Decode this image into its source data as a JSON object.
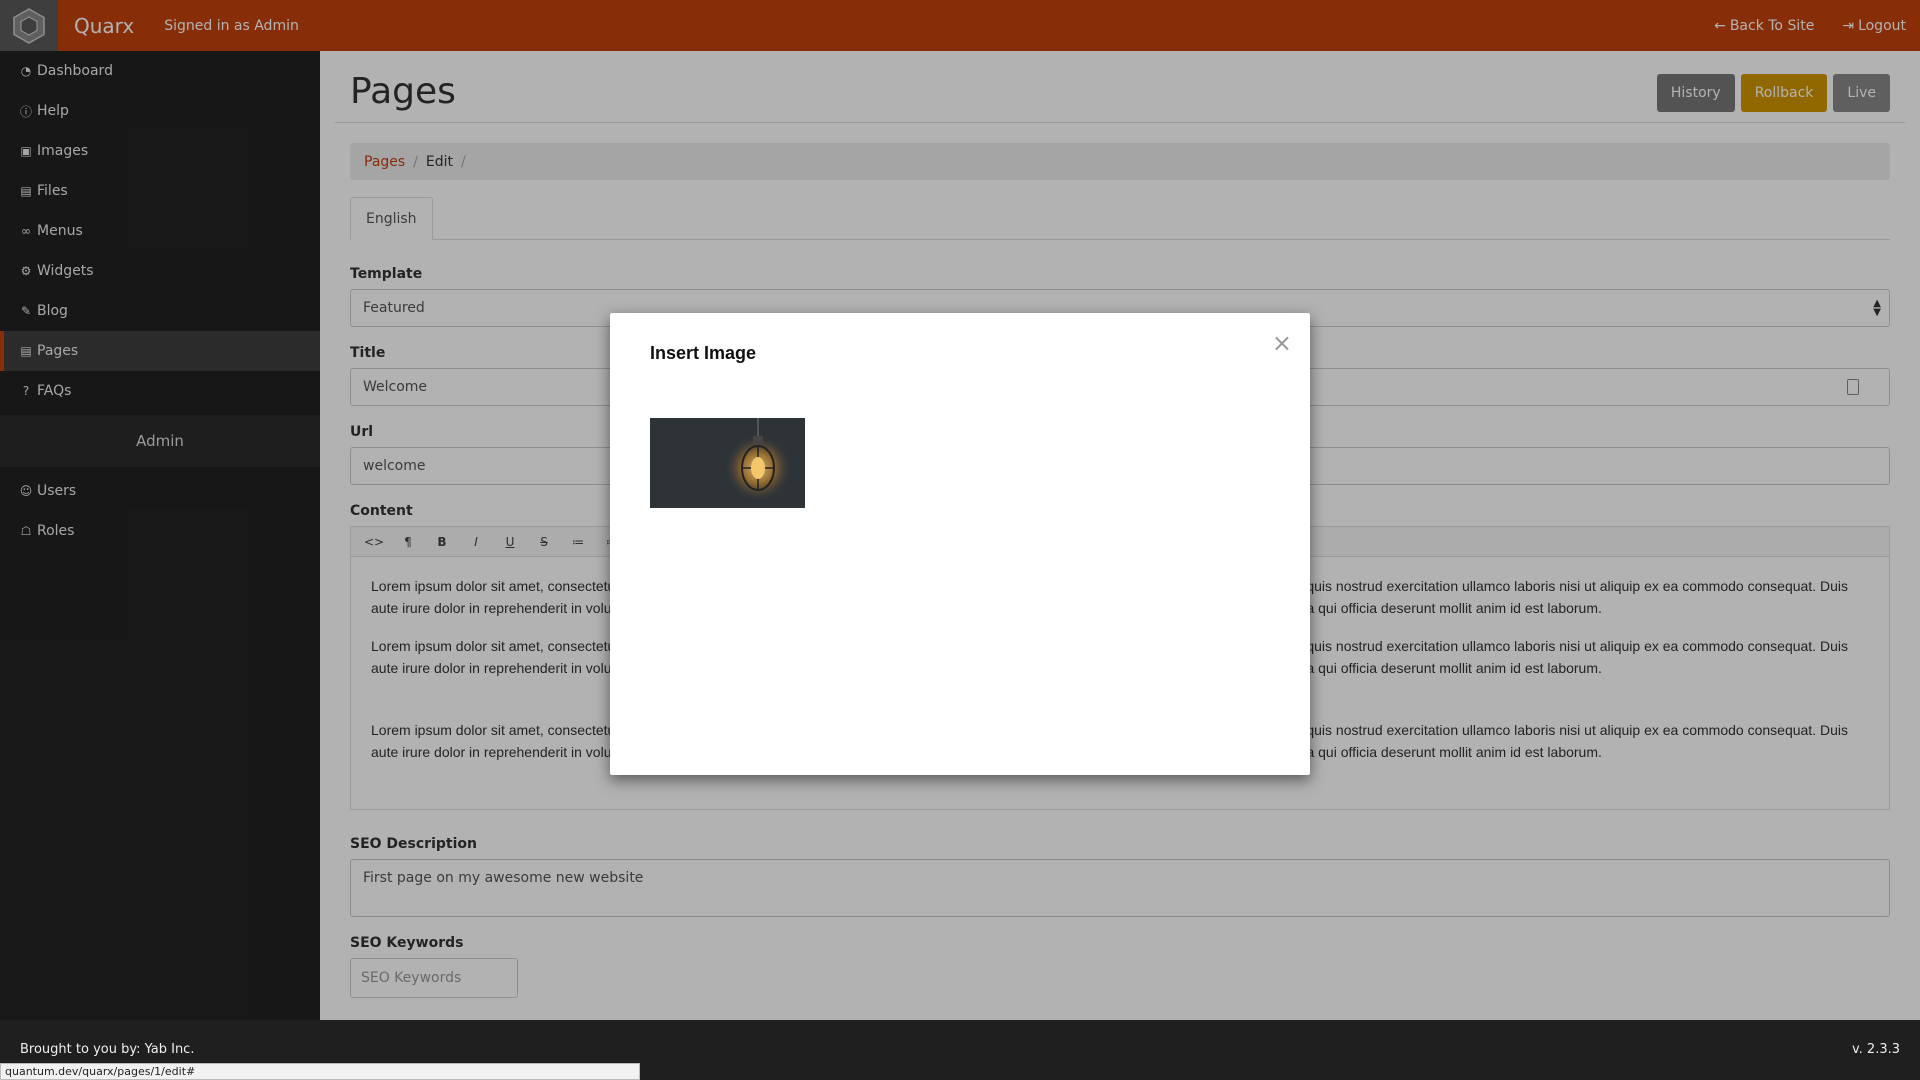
{
  "topbar": {
    "brand": "Quarx",
    "signed_in": "Signed in as Admin",
    "back_to_site": "Back To Site",
    "logout": "Logout",
    "back_icon": "arrow-left-icon",
    "logout_icon": "sign-out-icon"
  },
  "sidebar": {
    "items": [
      {
        "label": "Dashboard",
        "icon": "dashboard-icon",
        "glyph": "◔"
      },
      {
        "label": "Help",
        "icon": "info-icon",
        "glyph": "ⓘ"
      },
      {
        "label": "Images",
        "icon": "image-icon",
        "glyph": "▣"
      },
      {
        "label": "Files",
        "icon": "file-icon",
        "glyph": "▤"
      },
      {
        "label": "Menus",
        "icon": "link-icon",
        "glyph": "∞"
      },
      {
        "label": "Widgets",
        "icon": "gear-icon",
        "glyph": "⚙"
      },
      {
        "label": "Blog",
        "icon": "pencil-icon",
        "glyph": "✎"
      },
      {
        "label": "Pages",
        "icon": "page-icon",
        "glyph": "▤"
      },
      {
        "label": "FAQs",
        "icon": "question-icon",
        "glyph": "?"
      }
    ],
    "section": "Admin",
    "admin_items": [
      {
        "label": "Users",
        "icon": "users-icon",
        "glyph": "👥"
      },
      {
        "label": "Roles",
        "icon": "lock-icon",
        "glyph": "🔒"
      }
    ]
  },
  "header": {
    "title": "Pages",
    "history": "History",
    "rollback": "Rollback",
    "live": "Live"
  },
  "breadcrumb": {
    "pages": "Pages",
    "edit": "Edit",
    "sep": "/"
  },
  "tabs": [
    "English"
  ],
  "form": {
    "template_label": "Template",
    "template_value": "Featured",
    "title_label": "Title",
    "title_value": "Welcome",
    "url_label": "Url",
    "url_value": "welcome",
    "content_label": "Content",
    "toolbar": [
      "<>",
      "¶",
      "B",
      "I",
      "U",
      "S",
      "≔",
      "≔"
    ],
    "paragraphs": [
      "Lorem ipsum dolor sit amet, consectetur adipisicing elit, sed do eiusmod tempor incididunt ut labore et dolore magna aliqua. Ut enim ad minim veniam, quis nostrud exercitation ullamco laboris nisi ut aliquip ex ea commodo consequat. Duis aute irure dolor in reprehenderit in voluptate velit esse cillum dolore eu fugiat nulla pariatur. Excepteur sint occaecat cupidatat non proident, sunt in culpa qui officia deserunt mollit anim id est laborum.",
      "Lorem ipsum dolor sit amet, consectetur adipisicing elit, sed do eiusmod tempor incididunt ut labore et dolore magna aliqua. Ut enim ad minim veniam, quis nostrud exercitation ullamco laboris nisi ut aliquip ex ea commodo consequat. Duis aute irure dolor in reprehenderit in voluptate velit esse cillum dolore eu fugiat nulla pariatur. Excepteur sint occaecat cupidatat non proident, sunt in culpa qui officia deserunt mollit anim id est laborum.",
      "Lorem ipsum dolor sit amet, consectetur adipisicing elit, sed do eiusmod tempor incididunt ut labore et dolore magna aliqua. Ut enim ad minim veniam, quis nostrud exercitation ullamco laboris nisi ut aliquip ex ea commodo consequat. Duis aute irure dolor in reprehenderit in voluptate velit esse cillum dolore eu fugiat nulla pariatur. Excepteur sint occaecat cupidatat non proident, sunt in culpa qui officia deserunt mollit anim id est laborum."
    ],
    "seo_desc_label": "SEO Description",
    "seo_desc_value": "First page on my awesome new website",
    "seo_kw_label": "SEO Keywords",
    "seo_kw_placeholder": "SEO Keywords"
  },
  "modal": {
    "title": "Insert Image",
    "close": "×",
    "image_icon": "lightbulb-image"
  },
  "footer": {
    "credit": "Brought to you by: Yab Inc.",
    "version": "v. 2.3.3",
    "status_url": "quantum.dev/quarx/pages/1/edit#"
  },
  "colors": {
    "brand": "#c2410c",
    "sidebar": "#222222",
    "rollback": "#d09400"
  }
}
